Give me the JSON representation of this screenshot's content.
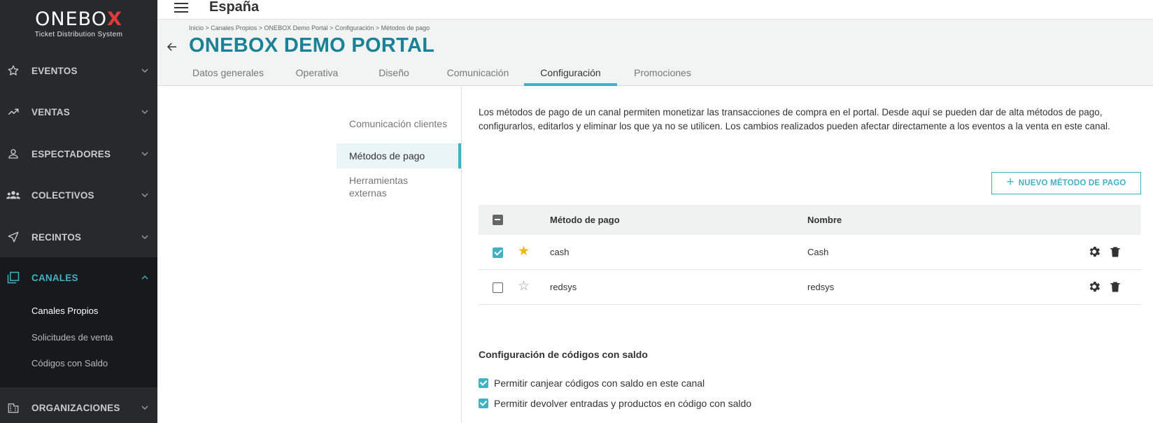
{
  "brand": {
    "name_prefix": "ONEBO",
    "name_x": "X",
    "tagline": "Ticket Distribution System"
  },
  "sidebar": {
    "items": [
      {
        "label": "EVENTOS",
        "icon": "star-icon"
      },
      {
        "label": "VENTAS",
        "icon": "trending-up-icon"
      },
      {
        "label": "ESPECTADORES",
        "icon": "person-icon"
      },
      {
        "label": "COLECTIVOS",
        "icon": "group-icon"
      },
      {
        "label": "RECINTOS",
        "icon": "navigation-icon"
      },
      {
        "label": "CANALES",
        "icon": "copy-icon",
        "active": true
      },
      {
        "label": "ORGANIZACIONES",
        "icon": "building-icon"
      }
    ],
    "subitems": [
      {
        "label": "Canales Propios",
        "selected": true
      },
      {
        "label": "Solicitudes de venta"
      },
      {
        "label": "Códigos con Saldo"
      }
    ]
  },
  "header": {
    "region": "España"
  },
  "page": {
    "breadcrumb": "Inicio > Canales Propios > ONEBOX Demo Portal > Configuración > Métodos de pago",
    "title": "ONEBOX DEMO PORTAL",
    "tabs": [
      "Datos generales",
      "Operativa",
      "Diseño",
      "Comunicación",
      "Configuración",
      "Promociones"
    ],
    "active_tab": "Configuración"
  },
  "submenu": {
    "items": [
      "Comunicación clientes",
      "Métodos de pago",
      "Herramientas externas"
    ],
    "active": "Métodos de pago"
  },
  "content": {
    "intro": "Los métodos de pago de un canal permiten monetizar las transacciones de compra en el portal. Desde aquí se pueden dar de alta métodos de pago, configurarlos, editarlos y eliminar los que ya no se utilicen. Los cambios realizados pueden afectar directamente a los eventos a la venta en este canal.",
    "new_button": "NUEVO MÉTODO DE PAGO",
    "table": {
      "headers": {
        "method": "Método de pago",
        "name": "Nombre"
      },
      "rows": [
        {
          "method": "cash",
          "name": "Cash",
          "checked": true,
          "default": true
        },
        {
          "method": "redsys",
          "name": "redsys",
          "checked": false,
          "default": false
        }
      ]
    },
    "balance_section": {
      "title": "Configuración de códigos con saldo",
      "options": [
        {
          "label": "Permitir canjear códigos con saldo en este canal",
          "checked": true
        },
        {
          "label": "Permitir devolver entradas y productos en código con saldo",
          "checked": true
        }
      ]
    }
  },
  "colors": {
    "accent": "#3fb2c4",
    "title": "#1a8196",
    "sidebar_bg": "#27292d",
    "star": "#f2b705"
  }
}
